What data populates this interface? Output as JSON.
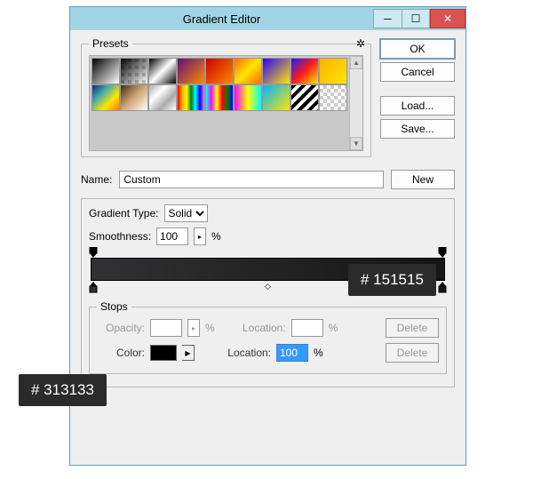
{
  "window": {
    "title": "Gradient Editor"
  },
  "buttons": {
    "ok": "OK",
    "cancel": "Cancel",
    "load": "Load...",
    "save": "Save...",
    "new": "New",
    "delete": "Delete"
  },
  "presets": {
    "legend": "Presets"
  },
  "name": {
    "label": "Name:",
    "value": "Custom"
  },
  "gradient": {
    "type_label": "Gradient Type:",
    "type_value": "Solid",
    "smoothness_label": "Smoothness:",
    "smoothness_value": "100",
    "percent": "%"
  },
  "stops": {
    "legend": "Stops",
    "opacity_label": "Opacity:",
    "opacity_value": "",
    "location_label": "Location:",
    "location1_value": "",
    "color_label": "Color:",
    "location2_value": "100"
  },
  "tooltips": {
    "left": "# 313133",
    "right": "# 151515"
  },
  "colors": {
    "left_stop": "#313133",
    "right_stop": "#151515"
  }
}
